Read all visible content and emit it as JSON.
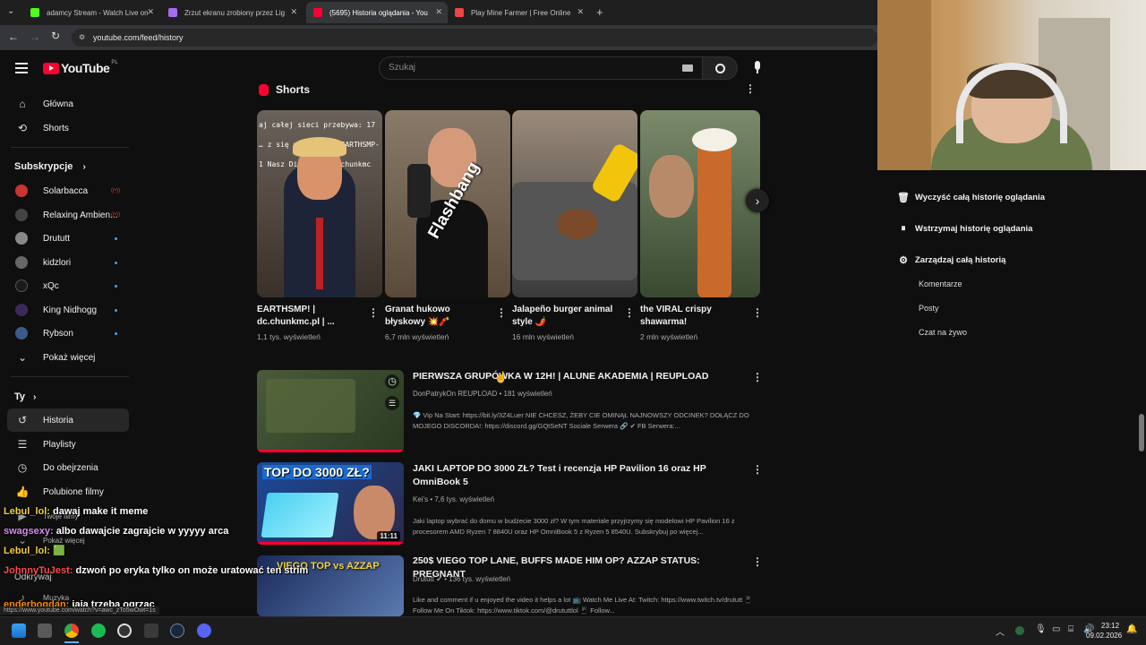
{
  "tabs": [
    {
      "label": "adamcy Stream - Watch Live on",
      "color": "#53fc18"
    },
    {
      "label": "Zrzut ekranu zrobiony przez Lig",
      "color": "#a46cf0"
    },
    {
      "label": "(5695) Historia oglądania - You",
      "color": "#ff0033"
    },
    {
      "label": "Play Mine Farmer | Free Online",
      "color": "#e44"
    }
  ],
  "new_tab_icon": "plus-icon",
  "url": "youtube.com/feed/history",
  "yt": {
    "logo": "YouTube",
    "region": "PL",
    "search_placeholder": "Szukaj",
    "nav": [
      {
        "label": "Główna",
        "icon": "home-icon"
      },
      {
        "label": "Shorts",
        "icon": "shorts-icon"
      }
    ],
    "subs_title": "Subskrypcje",
    "subs": [
      {
        "label": "Solarbacca",
        "badge": "live",
        "color": "#c33"
      },
      {
        "label": "Relaxing Ambien...",
        "badge": "live",
        "color": "#444"
      },
      {
        "label": "Drututt",
        "badge": "dot",
        "color": "#888"
      },
      {
        "label": "kidzlori",
        "badge": "dot",
        "color": "#666"
      },
      {
        "label": "xQc",
        "badge": "dot",
        "color": "#1a1a1a"
      },
      {
        "label": "King Nidhogg",
        "badge": "dot",
        "color": "#3a2a5a"
      },
      {
        "label": "Rybson",
        "badge": "dot",
        "color": "#3a5a8a"
      }
    ],
    "show_more": "Pokaż więcej",
    "you_title": "Ty",
    "you": [
      {
        "label": "Historia",
        "icon": "history-icon"
      },
      {
        "label": "Playlisty",
        "icon": "playlist-icon"
      },
      {
        "label": "Do obejrzenia",
        "icon": "clock-icon"
      },
      {
        "label": "Polubione filmy",
        "icon": "like-icon"
      },
      {
        "label": "Twoje filmy",
        "icon": "video-icon"
      },
      {
        "label": "Pokaż więcej",
        "icon": "chevron-down-icon"
      },
      {
        "label": "Odkrywaj",
        "icon": ""
      },
      {
        "label": "Muzyka",
        "icon": "music-icon"
      }
    ],
    "shorts_title": "Shorts",
    "shorts": [
      {
        "title": "EARTHSMP! | dc.chunkmc.pl | ...",
        "views": "1,1 tys. wyświetleń",
        "bg": "#5a5048",
        "overlay": "aj całej sieci przebywa: 17 … z się na trybie: EARTHSMP-1 Nasz Discord: dc.chunkmc"
      },
      {
        "title": "Granat hukowo błyskowy 💥🧨",
        "views": "6,7 mln wyświetleń",
        "bg": "#7a6a5a",
        "overlay": "Flashbang"
      },
      {
        "title": "Jalapeño burger animal style 🌶️",
        "views": "16 mln wyświetleń",
        "bg": "#6a6a6a",
        "overlay": ""
      },
      {
        "title": "the VIRAL crispy shawarma!",
        "views": "2 mln wyświetleń",
        "bg": "#5a6a52",
        "overlay": ""
      }
    ],
    "videos": [
      {
        "title": "PIERWSZA GRUPÓWKA W 12H! | ALUNE AKADEMIA | REUPLOAD",
        "meta": "DonPatrykOn REUPLOAD • 181 wyświetleń",
        "desc": "💎 Vip Na Start: https://bit.ly/3Z4Luer NIE CHCESZ, ŻEBY CIE OMINĄŁ NAJNOWSZY ODCINEK? DOŁĄCZ DO MOJEGO DISCORDA!: https://discord.gg/GQtSeNT Sociale Serwera 🔗 ✔ FB Serwera:...",
        "duration": "",
        "bg": "#3a4a2a"
      },
      {
        "title": "JAKI LAPTOP DO 3000 ZŁ? Test i recenzja HP Pavilion 16 oraz HP OmniBook 5",
        "meta": "Kei's • 7,6 tys. wyświetleń",
        "desc": "Jaki laptop wybrać do domu w budżecie 3000 zł? W tym materiale przyjrzymy się modelowi HP Pavilion 16 z procesorem AMD Ryzen 7 8840U oraz HP OmniBook 5 z Ryzen 5 8540U. Subskrybuj po więcej...",
        "duration": "11:11",
        "bg": "#2a4a8a",
        "thumb_text": "TOP DO 3000 ZŁ?"
      },
      {
        "title": "250$ VIEGO TOP LANE, BUFFS MADE HIM OP? AZZAP STATUS: PREGNANT",
        "meta": "Drututt ✔ • 136 tys. wyświetleń",
        "desc": "Like and comment if u enjoyed the video it helps a lot 📺 Watch Me Live At: Twitch: https://www.twitch.tv/drututt 📱 Follow Me On Tiktok: https://www.tiktok.com/@drututtlol 📱 Follow...",
        "duration": "",
        "bg": "#2a3a6a",
        "thumb_text": "VIEGO TOP vs AZZAP"
      }
    ],
    "right_panel": {
      "clear": "Wyczyść całą historię oglądania",
      "pause": "Wstrzymaj historię oglądania",
      "manage": "Zarządzaj całą historią",
      "subs": [
        "Komentarze",
        "Posty",
        "Czat na żywo"
      ]
    }
  },
  "chat": [
    {
      "user": "Lebul_lol:",
      "msg": "dawaj make it meme",
      "color": "#f4d03f"
    },
    {
      "user": "swagsexy:",
      "msg": "albo dawajcie zagrajcie w yyyyy arca",
      "color": "#d98cf0"
    },
    {
      "user": "Lebul_lol:",
      "msg": "🟩",
      "color": "#f4d03f"
    },
    {
      "user": "JohnnyTuJest:",
      "msg": "dzwoń po eryka tylko on może uratować ten strim",
      "color": "#ff4d4d"
    },
    {
      "user": "enderbogdan:",
      "msg": "jaja trzeba ogrzac",
      "color": "#ff8c00"
    }
  ],
  "status_url": "https://www.youtube.com/watch?v=awc_zTo5wOwt=1s",
  "clock": {
    "time": "23:12",
    "date": "09.02.2026"
  },
  "colors": {
    "accent": "#ff0033",
    "bg": "#0f0f0f",
    "chrome": "#35363a"
  }
}
